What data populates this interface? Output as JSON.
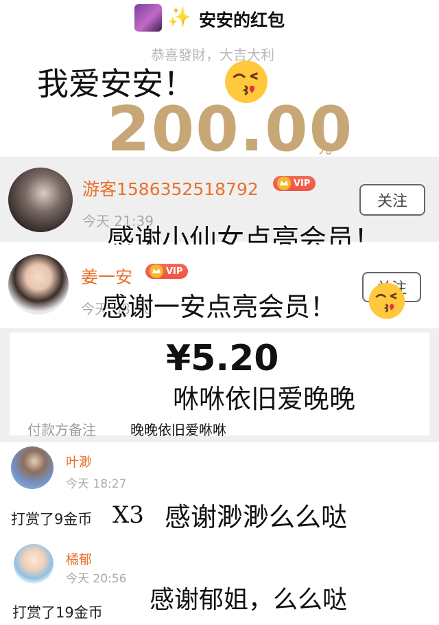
{
  "header": {
    "title": "安安的红包",
    "sparkle": "✨"
  },
  "greeting": "恭喜發財，大吉大利",
  "big_amount": "200.00",
  "unit": "元",
  "caption_top": "我爱安安！",
  "user1": {
    "name": "游客1586352518792",
    "time": "今天 21:39",
    "vip": "VIP",
    "follow": "关注"
  },
  "caption_user1": "感谢小仙女点亮会员！",
  "user2": {
    "name": "姜一安",
    "time": "今天 08:36",
    "vip": "VIP",
    "follow": "关注"
  },
  "caption_user2": "感谢一安点亮会员！",
  "payment": {
    "amount": "¥5.20",
    "caption": "咻咻依旧爱晚晚",
    "remark_label": "付款方备注",
    "remark_value": "晚晚依旧爱咻咻"
  },
  "reward1": {
    "name": "叶渺",
    "time": "今天 18:27",
    "text": "打赏了9金币",
    "multiplier": "X3",
    "caption": "感谢渺渺么么哒"
  },
  "reward2": {
    "name": "橘郁",
    "time": "今天 20:56",
    "text": "打赏了19金币",
    "caption": "感谢郁姐，么么哒"
  },
  "colors": {
    "gold": "#c8a777",
    "orange": "#e8702a",
    "vip_red": "#ef5341",
    "gray_panel": "#efefef"
  }
}
